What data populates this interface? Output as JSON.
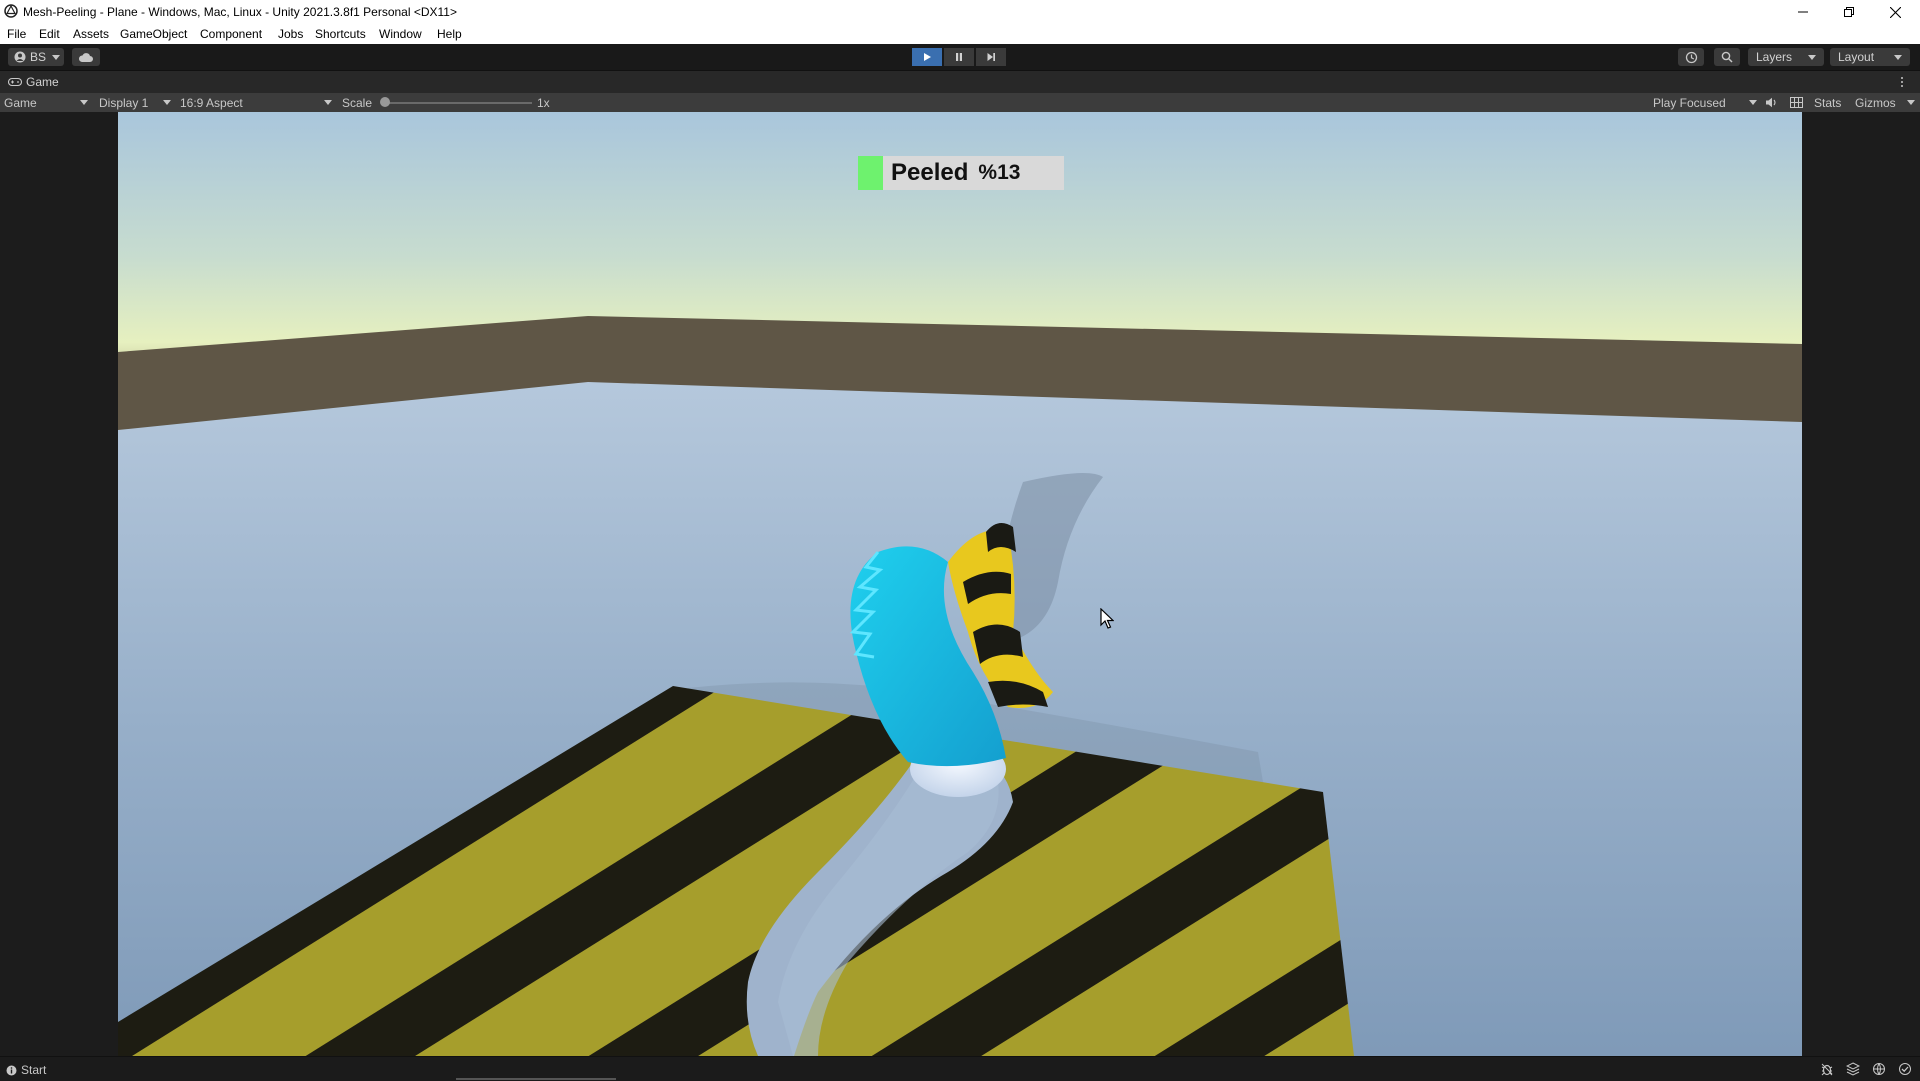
{
  "window": {
    "title": "Mesh-Peeling - Plane - Windows, Mac, Linux - Unity 2021.3.8f1 Personal <DX11>"
  },
  "menu": [
    "File",
    "Edit",
    "Assets",
    "GameObject",
    "Component",
    "Jobs",
    "Shortcuts",
    "Window",
    "Help"
  ],
  "toolbar": {
    "account_label": "BS",
    "layers_label": "Layers",
    "layout_label": "Layout"
  },
  "tab": {
    "label": "Game"
  },
  "gamebar": {
    "mode": "Game",
    "display": "Display 1",
    "aspect": "16:9 Aspect",
    "scale_label": "Scale",
    "scale_value": "1x",
    "scale_fraction": 0.0,
    "play_mode": "Play Focused",
    "stats": "Stats",
    "gizmos": "Gizmos"
  },
  "hud": {
    "label": "Peeled",
    "percent": "%13",
    "indicator_color": "#6ef26e"
  },
  "status": {
    "label": "Start"
  },
  "colors": {
    "accent_play": "#3a6fb0",
    "stripe_yellow": "#a8a02a",
    "stripe_black": "#1a1a14",
    "peel_cyan": "#22c8e6",
    "peel_yellow": "#f0d020"
  }
}
